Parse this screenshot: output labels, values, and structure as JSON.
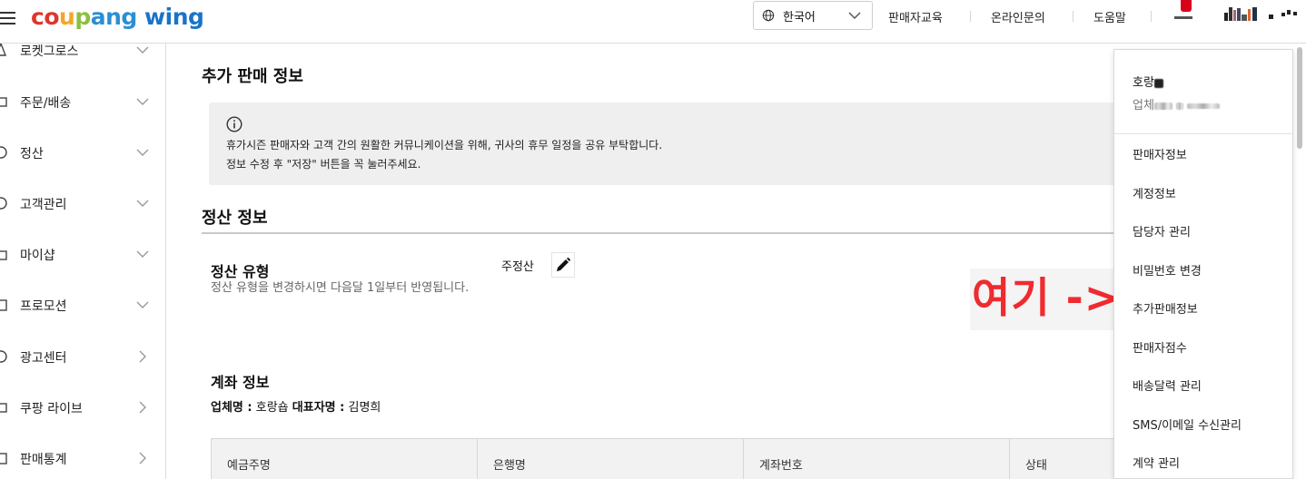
{
  "header": {
    "logo": {
      "part1": "coupang",
      "part2": "wing"
    },
    "language": "한국어",
    "links": [
      "판매자교육",
      "온라인문의",
      "도움말"
    ]
  },
  "sidebar": {
    "items": [
      {
        "label": "로켓그로스",
        "icon": "rocket-icon"
      },
      {
        "label": "주문/배송",
        "icon": "truck-icon"
      },
      {
        "label": "정산",
        "icon": "won-icon"
      },
      {
        "label": "고객관리",
        "icon": "chat-icon"
      },
      {
        "label": "마이샵",
        "icon": "shop-icon"
      },
      {
        "label": "프로모션",
        "icon": "promo-icon"
      },
      {
        "label": "광고센터",
        "icon": "ad-icon"
      },
      {
        "label": "쿠팡 라이브",
        "icon": "live-icon"
      },
      {
        "label": "판매통계",
        "icon": "stats-icon"
      }
    ]
  },
  "main": {
    "title": "추가 판매 정보",
    "notice": {
      "line1": "휴가시즌 판매자와 고객 간의 원활한 커뮤니케이션을 위해, 귀사의 휴무 일정을 공유 부탁합니다.",
      "line2": "정보 수정 후 \"저장\" 버튼을 꼭 눌러주세요."
    },
    "settlement": {
      "section_title": "정산 정보",
      "type_title": "정산 유형",
      "type_desc": "정산 유형을 변경하시면 다음달 1일부터 반영됩니다.",
      "type_value": "주정산"
    },
    "account": {
      "title": "계좌 정보",
      "company_label": "업체명 :",
      "company_value": "호랑숍",
      "rep_label": "대표자명 :",
      "rep_value": "김명희",
      "columns": [
        "예금주명",
        "은행명",
        "계좌번호",
        "상태"
      ]
    }
  },
  "annotation": "여기 ->",
  "dropdown": {
    "name": "호랑",
    "company": "업체",
    "items": [
      "판매자정보",
      "계정정보",
      "담당자 관리",
      "비밀번호 변경",
      "추가판매정보",
      "판매자점수",
      "배송달력 관리",
      "SMS/이메일 수신관리",
      "계약 관리"
    ]
  },
  "colors": {
    "logo_c": "#e0352b",
    "logo_o": "#f5a623",
    "logo_u": "#8bbf3f",
    "logo_p": "#2a8fd4",
    "logo_wing": "#1a73c9",
    "annotation": "#ef2b30",
    "badge": "#d9001b"
  }
}
